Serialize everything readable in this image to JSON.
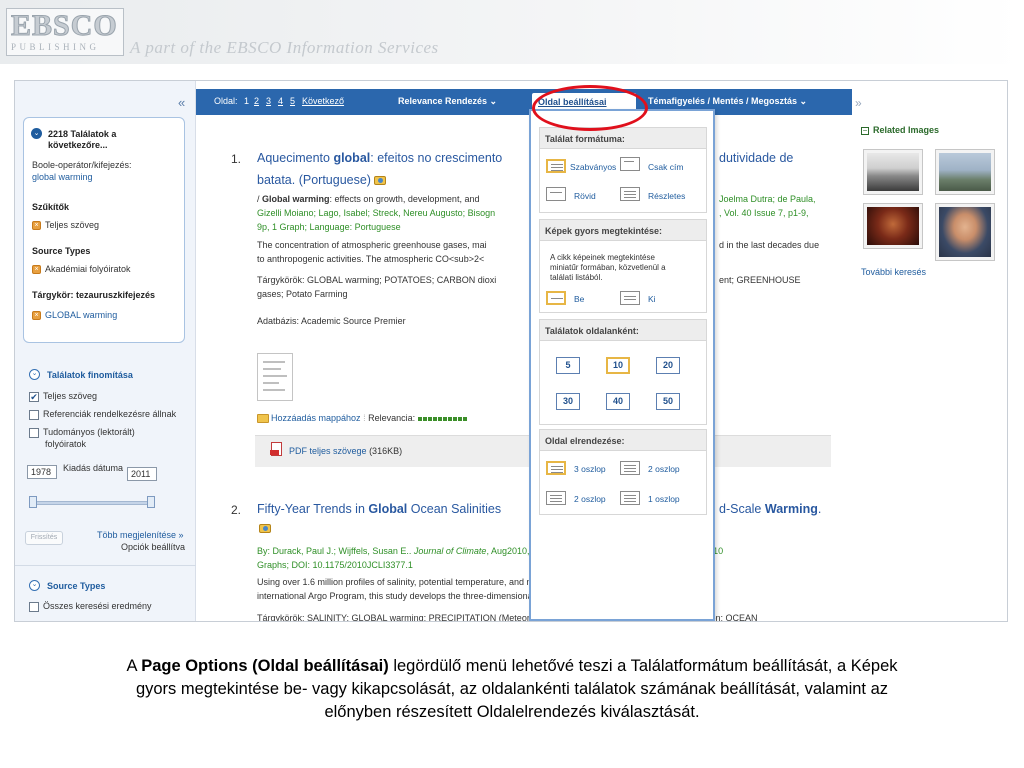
{
  "banner": {
    "logo_main": "EBSCO",
    "logo_sub": "PUBLISHING",
    "tagline": "A part of the EBSCO Information Services"
  },
  "sidebar": {
    "collapse": "«",
    "results_count": "2218 Találatok a",
    "results_next": "következőre...",
    "boolean_label": "Boole-operátor/kifejezés:",
    "boolean_value": "global warming",
    "narrow_head": "Szűkítők",
    "narrow_item": "Teljes szöveg",
    "source_head": "Source Types",
    "source_item": "Akadémiai folyóiratok",
    "subject_head": "Tárgykör: tezauruszkifejezés",
    "subject_item": "GLOBAL warming",
    "refine_head": "Találatok finomítása",
    "refine_items": [
      "Teljes szöveg",
      "Referenciák rendelkezésre állnak",
      "Tudományos (lektorált)",
      "folyóiratok"
    ],
    "date_from": "1978",
    "date_label": "Kiadás dátuma",
    "date_to": "2011",
    "refresh": "Frissítés",
    "more_options": "Több megjelenítése »",
    "options_shown": "Opciók beállítva",
    "source_types_head": "Source Types",
    "all_results": "Összes keresési eredmény"
  },
  "toolbar": {
    "page_label": "Oldal:",
    "pages": [
      "1",
      "2",
      "3",
      "4",
      "5"
    ],
    "next": "Következő",
    "sort": "Relevance Rendezés ⌄",
    "page_options": "Oldal beállításai",
    "share": "Témafigyelés / Mentés / Megosztás ⌄",
    "collapse": "»"
  },
  "results": [
    {
      "num": "1.",
      "title_a": "Aquecimento ",
      "title_b": "global",
      "title_c": ": efeitos no crescimento",
      "title_tail": "dutividade de",
      "title_line2": "batata. (Portuguese)",
      "line1_a": "/ ",
      "line1_b": "Global warming",
      "line1_c": ": effects on growth, development, and",
      "line1_tail": "Joelma Dutra; de Paula,",
      "line2": "Gizelli Moiano; Lago, Isabel; Streck, Nereu Augusto; Bisogn",
      "line2_tail": ", Vol. 40 Issue 7, p1-9,",
      "line3": "9p, 1 Graph; Language: Portuguese",
      "abs1": "The concentration of atmospheric greenhouse gases, mai",
      "abs1_tail": "d in the last decades due",
      "abs2": "to anthropogenic activities. The atmospheric CO<sub>2<",
      "subj1": "Tárgykörök: GLOBAL warming; POTATOES; CARBON dioxi",
      "subj1_tail": "ent; GREENHOUSE",
      "subj2": "gases; Potato Farming",
      "db": "Adatbázis: Academic Source Premier",
      "add_folder": "Hozzáadás mappához",
      "relevance": "Relevancia:",
      "pdf": "PDF teljes szövege",
      "pdf_size": "(316KB)"
    },
    {
      "num": "2.",
      "title_a": "Fifty-Year Trends in ",
      "title_b": "Global",
      "title_c": " Ocean Salinities",
      "title_tail_a": "d-Scale ",
      "title_tail_b": "Warming",
      "title_tail_c": ".",
      "by_a": "By: Durack, Paul J.; Wijffels, Susan E.. ",
      "by_journal": "Journal of Climate",
      "by_b": ", Aug2010, Vol. 23 Issue 16, p4342-4362, 21p, 2 Charts, 10",
      "by_line2": "Graphs; DOI: 10.1175/2010JCLI3377.1",
      "abs1": "Using over 1.6 million profiles of salinity, potential temperature, and neutral density from historical archives and the",
      "abs2": "international Argo Program, this study develops the three-dimensional fiel...",
      "subj_cut": "Tárgykörök: SALINITY; GLOBAL warming; PRECIPITATION (Meteorology); CLIMATOLOGY; SOUTHERN oscillation; OCEAN"
    }
  ],
  "dropdown": {
    "format_head": "Találat formátuma:",
    "format_options": [
      "Szabványos",
      "Csak cím",
      "Rövid",
      "Részletes"
    ],
    "preview_head": "Képek gyors megtekintése:",
    "preview_text": [
      "A cikk képeinek megtekintése",
      "miniatűr formában, közvetlenül a",
      "találati listából."
    ],
    "preview_options": [
      "Be",
      "Ki"
    ],
    "perpage_head": "Találatok oldalanként:",
    "perpage_values": [
      "5",
      "10",
      "20",
      "30",
      "40",
      "50"
    ],
    "perpage_selected": "10",
    "layout_head": "Oldal elrendezése:",
    "layout_options": [
      "3 oszlop",
      "2 oszlop",
      "2 oszlop",
      "1 oszlop"
    ]
  },
  "right": {
    "head": "Related Images",
    "more": "További keresés"
  },
  "caption": {
    "a": "A ",
    "bold": "Page Options (Oldal beállításai)",
    "b": " legördülő menü lehetővé teszi a Találatformátum beállítását, a Képek",
    "line2": "gyors megtekintése be- vagy kikapcsolását, az oldalankénti találatok számának beállítását, valamint az",
    "line3": "előnyben részesített Oldalelrendezés kiválasztását."
  },
  "colors": {
    "toolbar": "#2b67ad",
    "annotation": "#e0101c",
    "link": "#2958a0",
    "selected_border": "#e7b645"
  }
}
